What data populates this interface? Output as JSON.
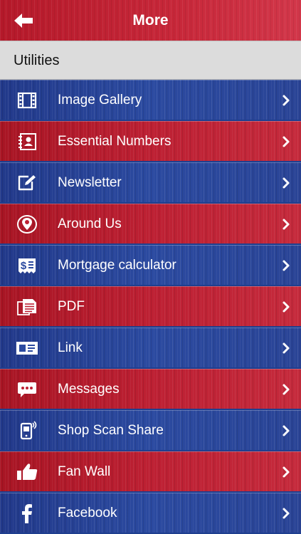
{
  "header": {
    "title": "More",
    "back_icon": "back-arrow-icon"
  },
  "section": {
    "label": "Utilities"
  },
  "colors": {
    "blue_row": "#2b4aa0",
    "red_row": "#bd2033",
    "header_red": "#c8283a",
    "section_gray": "#dcdcdc"
  },
  "menu": {
    "items": [
      {
        "label": "Image Gallery",
        "icon": "film-icon",
        "color": "blue"
      },
      {
        "label": "Essential Numbers",
        "icon": "contact-card-icon",
        "color": "red"
      },
      {
        "label": "Newsletter",
        "icon": "compose-icon",
        "color": "blue"
      },
      {
        "label": "Around Us",
        "icon": "location-pin-icon",
        "color": "red"
      },
      {
        "label": "Mortgage calculator",
        "icon": "dollar-receipt-icon",
        "color": "blue"
      },
      {
        "label": "PDF",
        "icon": "document-icon",
        "color": "red"
      },
      {
        "label": "Link",
        "icon": "id-card-icon",
        "color": "blue"
      },
      {
        "label": "Messages",
        "icon": "chat-bubble-icon",
        "color": "red"
      },
      {
        "label": "Shop Scan Share",
        "icon": "scan-phone-icon",
        "color": "blue"
      },
      {
        "label": "Fan Wall",
        "icon": "thumbs-up-icon",
        "color": "red"
      },
      {
        "label": "Facebook",
        "icon": "facebook-icon",
        "color": "blue"
      }
    ]
  }
}
